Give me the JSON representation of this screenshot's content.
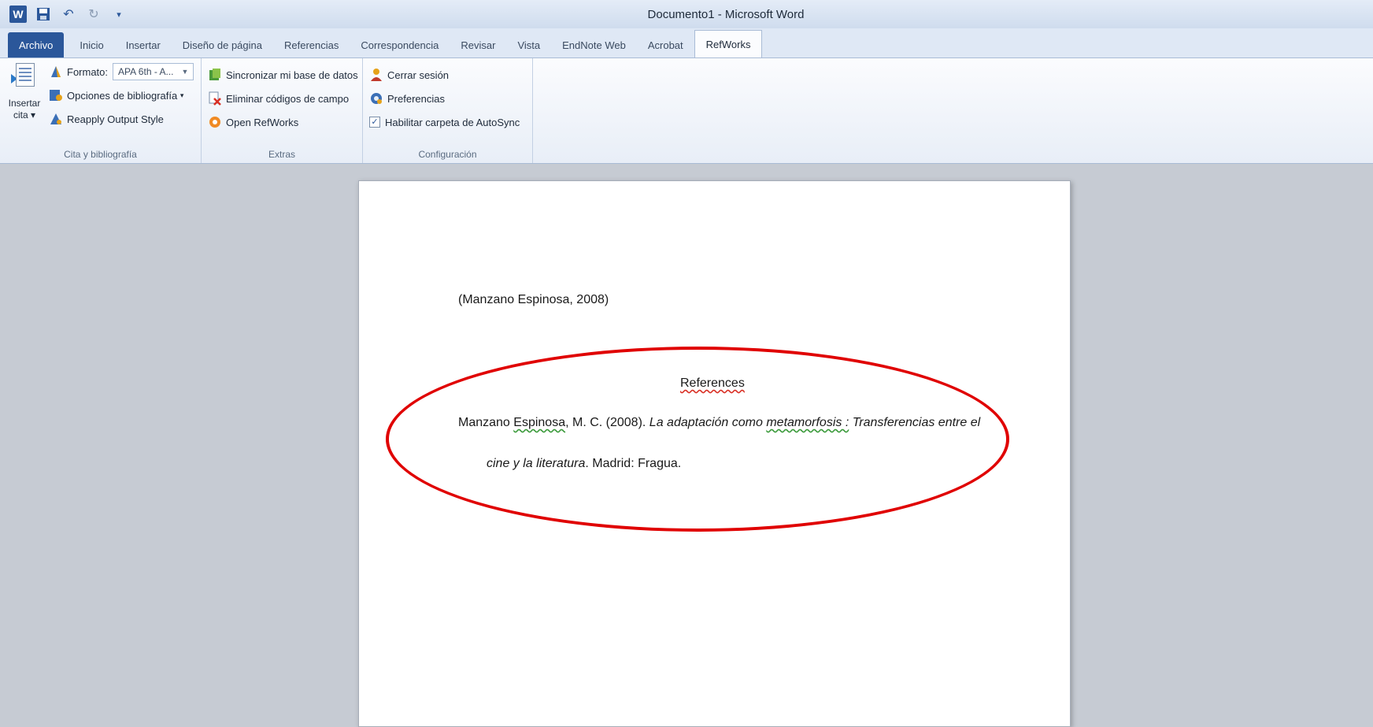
{
  "window": {
    "title": "Documento1 - Microsoft Word",
    "app_logo": "W"
  },
  "quick_access": {
    "icons": [
      "word-icon",
      "save-icon",
      "undo-icon",
      "redo-icon",
      "customize-icon"
    ]
  },
  "tabs": [
    {
      "label": "Archivo"
    },
    {
      "label": "Inicio"
    },
    {
      "label": "Insertar"
    },
    {
      "label": "Diseño de página"
    },
    {
      "label": "Referencias"
    },
    {
      "label": "Correspondencia"
    },
    {
      "label": "Revisar"
    },
    {
      "label": "Vista"
    },
    {
      "label": "EndNote Web"
    },
    {
      "label": "Acrobat"
    },
    {
      "label": "RefWorks"
    }
  ],
  "ribbon": {
    "group1": {
      "label": "Cita y bibliografía",
      "insert_label": "Insertar",
      "insert_label2": "cita",
      "format_label": "Formato:",
      "format_value": "APA 6th - A...",
      "bib_options": "Opciones de bibliografía",
      "reapply": "Reapply Output Style"
    },
    "group2": {
      "label": "Extras",
      "sync": "Sincronizar mi base de datos",
      "remove_codes": "Eliminar códigos de campo",
      "open": "Open RefWorks"
    },
    "group3": {
      "label": "Configuración",
      "logout": "Cerrar sesión",
      "prefs": "Preferencias",
      "autosync": "Habilitar carpeta de AutoSync",
      "autosync_checked": true
    }
  },
  "document": {
    "citation": "(Manzano Espinosa, 2008)",
    "references_heading": "References",
    "ref_author1": "Manzano ",
    "ref_author2": "Espinosa",
    "ref_author3": ", M. C. (2008). ",
    "ref_title1": "La adaptación como ",
    "ref_title2": "metamorfosis :",
    "ref_title3": " Transferencias entre el",
    "ref_line2_title": "cine y la literatura",
    "ref_line2_rest": ". Madrid: Fragua."
  },
  "annotation": {
    "color": "#e00000"
  }
}
